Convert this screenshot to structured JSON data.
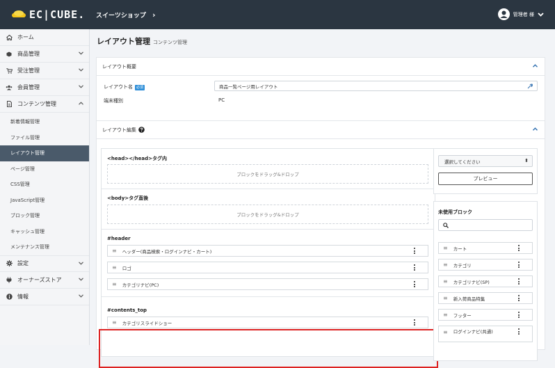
{
  "header": {
    "logo_text": "EC|CUBE.",
    "shop_name": "スイーツショップ",
    "shop_chevron": "›",
    "user_label": "管理者 様"
  },
  "sidebar": {
    "items": [
      {
        "label": "ホーム",
        "icon": "home-icon"
      },
      {
        "label": "商品管理",
        "icon": "cube-icon"
      },
      {
        "label": "受注管理",
        "icon": "cart-icon"
      },
      {
        "label": "会員管理",
        "icon": "users-icon"
      },
      {
        "label": "コンテンツ管理",
        "icon": "file-icon"
      }
    ],
    "sub_items": [
      "新着情報管理",
      "ファイル管理",
      "レイアウト管理",
      "ページ管理",
      "CSS管理",
      "JavaScript管理",
      "ブロック管理",
      "キャッシュ管理",
      "メンテナンス管理"
    ],
    "bottom_items": [
      {
        "label": "設定",
        "icon": "gear-icon"
      },
      {
        "label": "オーナーズストア",
        "icon": "plug-icon"
      },
      {
        "label": "情報",
        "icon": "info-icon"
      }
    ]
  },
  "page": {
    "title": "レイアウト管理",
    "subtitle": "コンテンツ管理"
  },
  "overview": {
    "heading": "レイアウト概要",
    "name_label": "レイアウト名",
    "required_badge": "必須",
    "name_value": "商品一覧ページ用レイアウト",
    "device_label": "端末種別",
    "device_value": "PC"
  },
  "editor": {
    "heading": "レイアウト編集",
    "head_zone": "<head></head>タグ内",
    "body_zone": "<body>タグ直後",
    "drop_text": "ブロックをドラッグ&ドロップ",
    "header_zone": "#header",
    "header_blocks": [
      "ヘッダー(商品検索・ログインナビ・カート)",
      "ロゴ",
      "カテゴリナビ(PC)"
    ],
    "contents_top_zone": "#contents_top",
    "contents_top_blocks": [
      "カテゴリスライドショー"
    ]
  },
  "right_panel": {
    "select_placeholder": "選択してください",
    "preview_button": "プレビュー",
    "unused_title": "未使用ブロック",
    "unused_blocks": [
      "カート",
      "カテゴリ",
      "カテゴリナビ(SP)",
      "新入荷商品特集",
      "フッター",
      "ログインナビ(共通)"
    ]
  }
}
